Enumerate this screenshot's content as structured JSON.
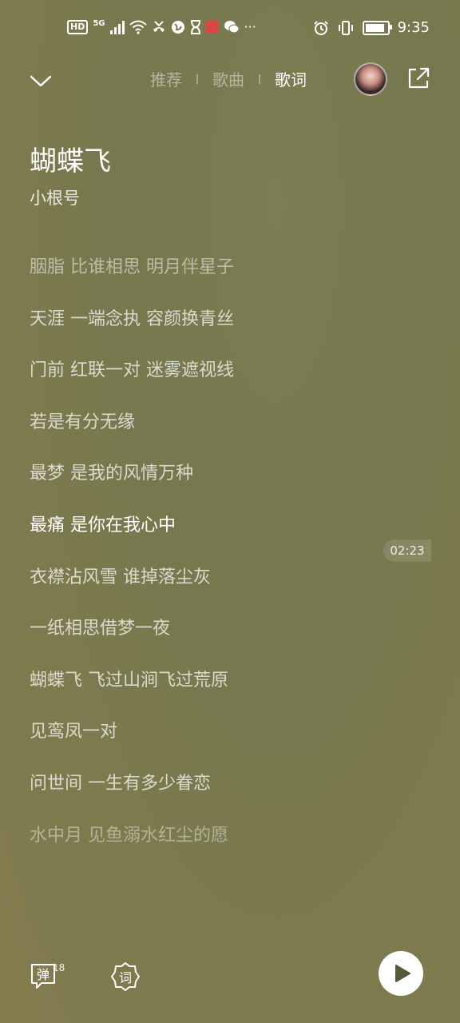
{
  "status_bar": {
    "hd": "HD",
    "network": "5G",
    "time": "9:35",
    "battery_level": 0.9
  },
  "nav": {
    "tabs": [
      {
        "label": "推荐",
        "active": false
      },
      {
        "label": "歌曲",
        "active": false
      },
      {
        "label": "歌词",
        "active": true
      }
    ]
  },
  "song": {
    "title": "蝴蝶飞",
    "singer": "小根号"
  },
  "lyrics": [
    "胭脂 比谁相思 明月伴星子",
    "天涯 一端念执 容颜换青丝",
    "门前 红联一对 迷雾遮视线",
    "若是有分无缘",
    "最梦 是我的风情万种",
    "最痛 是你在我心中",
    "衣襟沾风雪 谁掉落尘灰",
    "一纸相思借梦一夜",
    "蝴蝶飞 飞过山涧飞过荒原",
    "见鸾凤一对",
    "问世间 一生有多少眷恋",
    "水中月 见鱼溺水红尘的愿"
  ],
  "current_time": "02:23",
  "bottom": {
    "danmu_label": "弹",
    "danmu_count": "18",
    "ci_label": "词"
  },
  "icons": {
    "collapse": "chevron-down-icon",
    "share": "share-icon",
    "play": "play-icon"
  }
}
